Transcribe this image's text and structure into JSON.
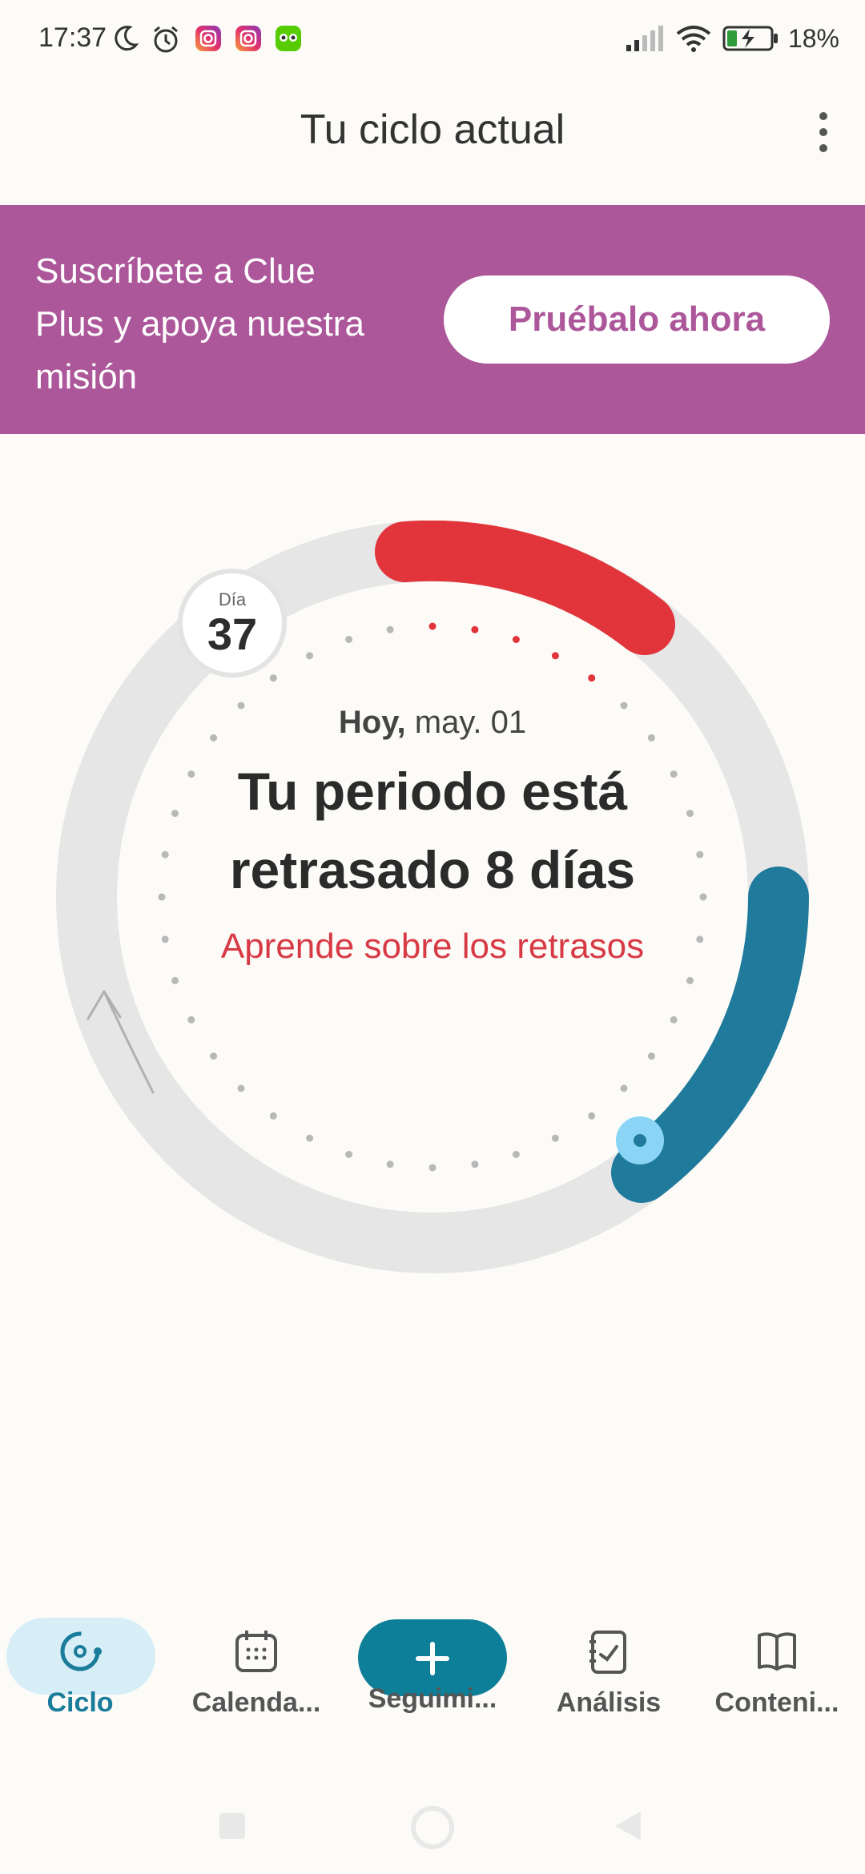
{
  "status_bar": {
    "time": "17:37",
    "battery": "18%"
  },
  "header": {
    "title": "Tu ciclo actual"
  },
  "banner": {
    "text": "Suscríbete a Clue Plus y apoya nuestra misión",
    "button": "Pruébalo ahora"
  },
  "cycle": {
    "day_label": "Día",
    "day_number": "37",
    "today_label": "Hoy,",
    "date": "may. 01",
    "headline": "Tu periodo está retrasado 8 días",
    "learn_link": "Aprende sobre los retrasos"
  },
  "nav": {
    "items": [
      {
        "label": "Ciclo",
        "icon": "cycle-icon",
        "active": true
      },
      {
        "label": "Calenda...",
        "icon": "calendar-icon"
      },
      {
        "label": "Seguimi...",
        "icon": "plus-icon"
      },
      {
        "label": "Análisis",
        "icon": "analysis-icon"
      },
      {
        "label": "Conteni...",
        "icon": "book-icon"
      }
    ]
  },
  "colors": {
    "banner": "#ad579b",
    "period": "#e1343b",
    "fertile": "#1f7a9b",
    "accent": "#0e7f98",
    "learn_link": "#d83a45"
  }
}
